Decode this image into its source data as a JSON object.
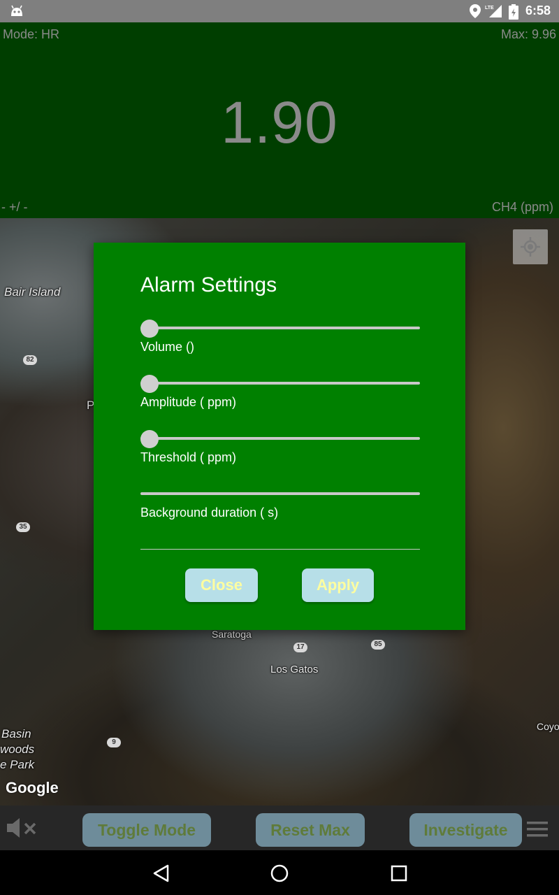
{
  "status_bar": {
    "time": "6:58",
    "network": "LTE"
  },
  "header": {
    "mode": "Mode: HR",
    "max": "Max: 9.96",
    "reading": "1.90",
    "plus_minus": "- +/ -",
    "unit": "CH4 (ppm)"
  },
  "map": {
    "labels": [
      "Bair Island",
      "P",
      "Saratoga",
      "Los Gatos",
      "Basin",
      "woods",
      "e Park",
      "Coyo"
    ],
    "shields": [
      "82",
      "35",
      "17",
      "85",
      "9"
    ],
    "attribution": "Google"
  },
  "dialog": {
    "title": "Alarm Settings",
    "volume_label": "Volume ()",
    "amplitude_label": "Amplitude ( ppm)",
    "threshold_label": "Threshold ( ppm)",
    "background_label": "Background duration ( s)",
    "volume_value": 0,
    "amplitude_value": 0,
    "threshold_value": 0,
    "close_label": "Close",
    "apply_label": "Apply"
  },
  "toolbar": {
    "toggle_mode": "Toggle Mode",
    "reset_max": "Reset Max",
    "investigate": "Investigate"
  },
  "icons": {
    "status": [
      "android-icon",
      "location-icon",
      "signal-icon",
      "battery-icon"
    ],
    "map": "my-location-icon",
    "toolbar": [
      "mute-icon",
      "menu-icon"
    ],
    "nav": [
      "back-icon",
      "home-icon",
      "recents-icon"
    ]
  },
  "colors": {
    "header_bg": "#003e00",
    "dialog_bg": "#008000",
    "button_bg": "#b7dfe8",
    "button_text": "#fdfda0"
  }
}
